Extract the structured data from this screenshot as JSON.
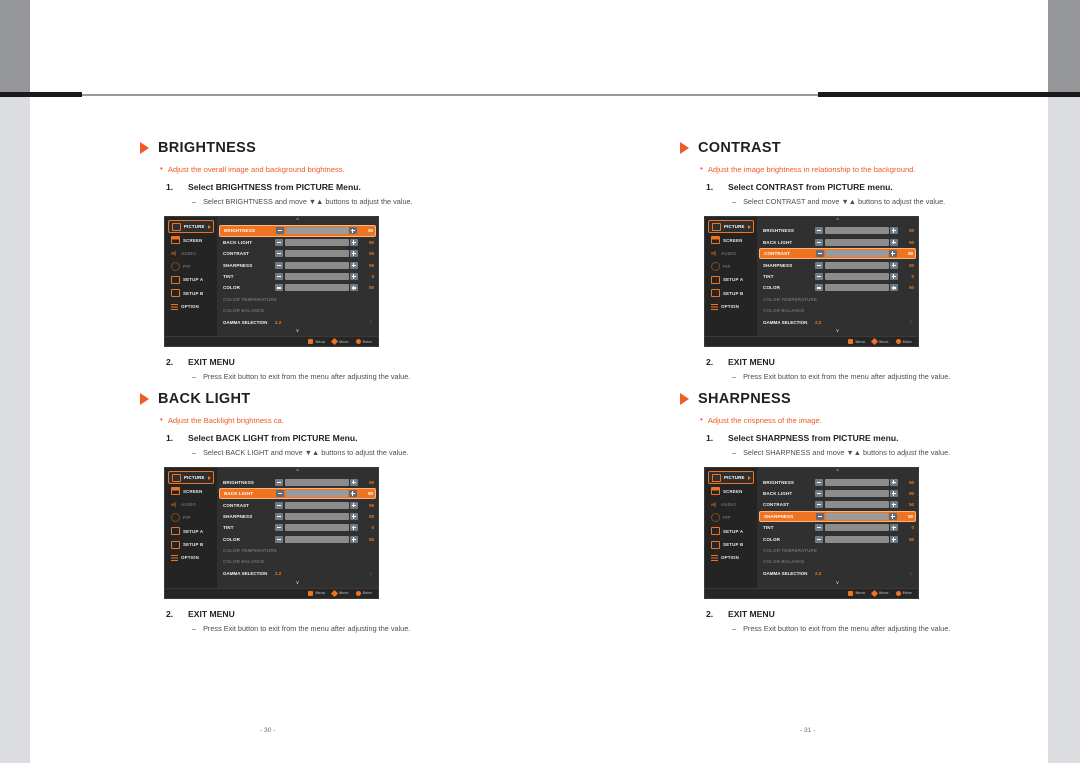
{
  "page": {
    "left_page_number": "- 30 -",
    "right_page_number": "- 31 -"
  },
  "colors": {
    "accent_orange": "#ef5a26",
    "osd_orange": "#f07c20",
    "text_dark": "#231f20",
    "osd_bg": "#303030"
  },
  "sections": [
    {
      "title": "BRIGHTNESS",
      "description": "Adjust the overall image and background brightness.",
      "step1_num": "1.",
      "step1_text": "Select BRIGHTNESS from PICTURE Menu.",
      "step1_sub": "Select BRIGHTNESS and move ▼▲ buttons to adjust the value.",
      "step2_num": "2.",
      "step2_text": "EXIT MENU",
      "step2_sub": "Press Exit button to exit from the menu after adjusting the value.",
      "osd": {
        "selected_row": "BRIGHTNESS",
        "sidebar": [
          {
            "label": "PICTURE",
            "icon": "picture-icon",
            "state": "active"
          },
          {
            "label": "SCREEN",
            "icon": "screen-icon",
            "state": "normal"
          },
          {
            "label": "AUDIO",
            "icon": "audio-icon",
            "state": "dim"
          },
          {
            "label": "PIP",
            "icon": "pip-icon",
            "state": "dim"
          },
          {
            "label": "SETUP A",
            "icon": "setup-a-icon",
            "state": "normal"
          },
          {
            "label": "SETUP B",
            "icon": "setup-b-icon",
            "state": "normal"
          },
          {
            "label": "OPTION",
            "icon": "option-icon",
            "state": "normal"
          }
        ],
        "rows": [
          {
            "label": "BRIGHTNESS",
            "value": "50",
            "fill": 55
          },
          {
            "label": "BACK LIGHT",
            "value": "90",
            "fill": 90
          },
          {
            "label": "CONTRAST",
            "value": "50",
            "fill": 55
          },
          {
            "label": "SHARPNESS",
            "value": "50",
            "fill": 55
          },
          {
            "label": "TINT",
            "value": "0",
            "fill": 55
          },
          {
            "label": "COLOR",
            "value": "50",
            "fill": 55
          }
        ],
        "dim_rows": [
          "COLOR TEMPERATURE",
          "COLOR BALANCE"
        ],
        "gamma_label": "GAMMA SELECTION",
        "gamma_value": "2.2",
        "footer": [
          {
            "label": "Menu",
            "icon": "menu-icon"
          },
          {
            "label": "Move",
            "icon": "move-icon"
          },
          {
            "label": "Enter",
            "icon": "enter-icon"
          }
        ]
      }
    },
    {
      "title": "BACK LIGHT",
      "description": "Adjust the Backlight brightness ca.",
      "step1_num": "1.",
      "step1_text": "Select BACK LIGHT from PICTURE Menu.",
      "step1_sub": "Select BACK LIGHT and move ▼▲ buttons to adjust the value.",
      "step2_num": "2.",
      "step2_text": "EXIT MENU",
      "step2_sub": "Press Exit button to exit from the menu after adjusting the value.",
      "osd": {
        "selected_row": "BACK LIGHT",
        "sidebar": [
          {
            "label": "PICTURE",
            "icon": "picture-icon",
            "state": "active"
          },
          {
            "label": "SCREEN",
            "icon": "screen-icon",
            "state": "normal"
          },
          {
            "label": "AUDIO",
            "icon": "audio-icon",
            "state": "dim"
          },
          {
            "label": "PIP",
            "icon": "pip-icon",
            "state": "dim"
          },
          {
            "label": "SETUP A",
            "icon": "setup-a-icon",
            "state": "normal"
          },
          {
            "label": "SETUP B",
            "icon": "setup-b-icon",
            "state": "normal"
          },
          {
            "label": "OPTION",
            "icon": "option-icon",
            "state": "normal"
          }
        ],
        "rows": [
          {
            "label": "BRIGHTNESS",
            "value": "50",
            "fill": 55
          },
          {
            "label": "BACK LIGHT",
            "value": "90",
            "fill": 90
          },
          {
            "label": "CONTRAST",
            "value": "50",
            "fill": 55
          },
          {
            "label": "SHARPNESS",
            "value": "50",
            "fill": 55
          },
          {
            "label": "TINT",
            "value": "0",
            "fill": 55
          },
          {
            "label": "COLOR",
            "value": "50",
            "fill": 55
          }
        ],
        "dim_rows": [
          "COLOR TEMPERATURE",
          "COLOR BALANCE"
        ],
        "gamma_label": "GAMMA SELECTION",
        "gamma_value": "2.2",
        "footer": [
          {
            "label": "Menu",
            "icon": "menu-icon"
          },
          {
            "label": "Move",
            "icon": "move-icon"
          },
          {
            "label": "Enter",
            "icon": "enter-icon"
          }
        ]
      }
    },
    {
      "title": "CONTRAST",
      "description": "Adjust the image brightness in relationship to the background.",
      "step1_num": "1.",
      "step1_text": "Select CONTRAST from PICTURE menu.",
      "step1_sub": "Select CONTRAST and move ▼▲ buttons to adjust the value.",
      "step2_num": "2.",
      "step2_text": "EXIT MENU",
      "step2_sub": "Press Exit button to exit from the menu after adjusting the value.",
      "osd": {
        "selected_row": "CONTRAST",
        "sidebar": [
          {
            "label": "PICTURE",
            "icon": "picture-icon",
            "state": "active"
          },
          {
            "label": "SCREEN",
            "icon": "screen-icon",
            "state": "normal"
          },
          {
            "label": "AUDIO",
            "icon": "audio-icon",
            "state": "dim"
          },
          {
            "label": "PIP",
            "icon": "pip-icon",
            "state": "dim"
          },
          {
            "label": "SETUP A",
            "icon": "setup-a-icon",
            "state": "normal"
          },
          {
            "label": "SETUP B",
            "icon": "setup-b-icon",
            "state": "normal"
          },
          {
            "label": "OPTION",
            "icon": "option-icon",
            "state": "normal"
          }
        ],
        "rows": [
          {
            "label": "BRIGHTNESS",
            "value": "50",
            "fill": 55
          },
          {
            "label": "BACK LIGHT",
            "value": "90",
            "fill": 90
          },
          {
            "label": "CONTRAST",
            "value": "50",
            "fill": 55
          },
          {
            "label": "SHARPNESS",
            "value": "50",
            "fill": 55
          },
          {
            "label": "TINT",
            "value": "0",
            "fill": 55
          },
          {
            "label": "COLOR",
            "value": "50",
            "fill": 55
          }
        ],
        "dim_rows": [
          "COLOR TEMPERATURE",
          "COLOR BALANCE"
        ],
        "gamma_label": "GAMMA SELECTION",
        "gamma_value": "2.2",
        "footer": [
          {
            "label": "Menu",
            "icon": "menu-icon"
          },
          {
            "label": "Move",
            "icon": "move-icon"
          },
          {
            "label": "Enter",
            "icon": "enter-icon"
          }
        ]
      }
    },
    {
      "title": "SHARPNESS",
      "description": "Adjust the crispness of the image.",
      "step1_num": "1.",
      "step1_text": "Select SHARPNESS from PICTURE menu.",
      "step1_sub": "Select SHARPNESS and move ▼▲ buttons to adjust the value.",
      "step2_num": "2.",
      "step2_text": "EXIT MENU",
      "step2_sub": "Press Exit button to exit from the menu after adjusting the value.",
      "osd": {
        "selected_row": "SHARPNESS",
        "sidebar": [
          {
            "label": "PICTURE",
            "icon": "picture-icon",
            "state": "active"
          },
          {
            "label": "SCREEN",
            "icon": "screen-icon",
            "state": "normal"
          },
          {
            "label": "AUDIO",
            "icon": "audio-icon",
            "state": "dim"
          },
          {
            "label": "PIP",
            "icon": "pip-icon",
            "state": "dim"
          },
          {
            "label": "SETUP A",
            "icon": "setup-a-icon",
            "state": "normal"
          },
          {
            "label": "SETUP B",
            "icon": "setup-b-icon",
            "state": "normal"
          },
          {
            "label": "OPTION",
            "icon": "option-icon",
            "state": "normal"
          }
        ],
        "rows": [
          {
            "label": "BRIGHTNESS",
            "value": "50",
            "fill": 55
          },
          {
            "label": "BACK LIGHT",
            "value": "90",
            "fill": 90
          },
          {
            "label": "CONTRAST",
            "value": "50",
            "fill": 55
          },
          {
            "label": "SHARPNESS",
            "value": "50",
            "fill": 55
          },
          {
            "label": "TINT",
            "value": "0",
            "fill": 55
          },
          {
            "label": "COLOR",
            "value": "50",
            "fill": 55
          }
        ],
        "dim_rows": [
          "COLOR TEMPERATURE",
          "COLOR BALANCE"
        ],
        "gamma_label": "GAMMA SELECTION",
        "gamma_value": "2.2",
        "footer": [
          {
            "label": "Menu",
            "icon": "menu-icon"
          },
          {
            "label": "Move",
            "icon": "move-icon"
          },
          {
            "label": "Enter",
            "icon": "enter-icon"
          }
        ]
      }
    }
  ]
}
